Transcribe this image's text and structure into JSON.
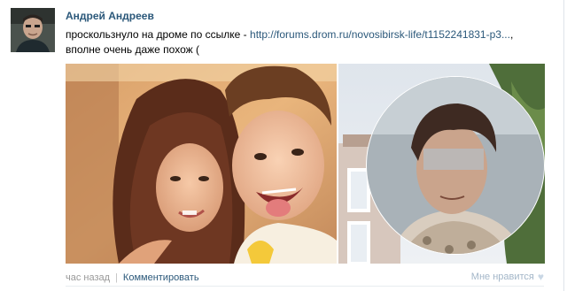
{
  "post": {
    "author": "Андрей Андреев",
    "text_before": "проскользнуло на дроме по ссылке - ",
    "link": "http://forums.drom.ru/novosibirsk-life/t1152241831-p3...",
    "text_after": ", вполне очень даже похож ("
  },
  "footer": {
    "time": "час назад",
    "separator": "|",
    "comment_label": "Комментировать",
    "like_label": "Мне нравится",
    "like_icon": "heart-icon"
  }
}
